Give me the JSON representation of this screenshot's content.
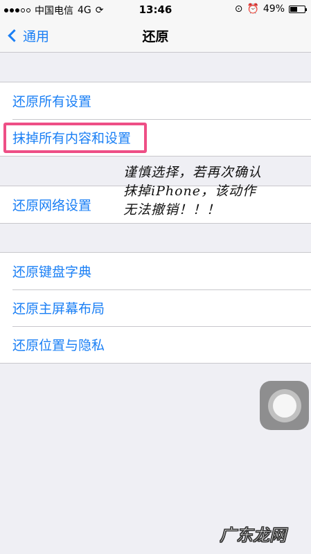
{
  "status_bar": {
    "carrier": "中国电信",
    "network": "4G",
    "time": "13:46",
    "battery_percent": "49%",
    "battery_level": 0.49
  },
  "nav": {
    "back_label": "通用",
    "title": "还原"
  },
  "groups": [
    {
      "items": [
        "还原所有设置",
        "抹掉所有内容和设置"
      ]
    },
    {
      "items": [
        "还原网络设置"
      ]
    },
    {
      "items": [
        "还原键盘字典",
        "还原主屏幕布局",
        "还原位置与隐私"
      ]
    }
  ],
  "annotation": {
    "lines": [
      "谨慎选择，若再次确认",
      "抹掉iPhone，该动作",
      "无法撤销！！！"
    ]
  },
  "watermark": "广东龙网",
  "colors": {
    "accent": "#1a7ff5",
    "highlight": "#ee4f86",
    "background": "#efeff4"
  }
}
